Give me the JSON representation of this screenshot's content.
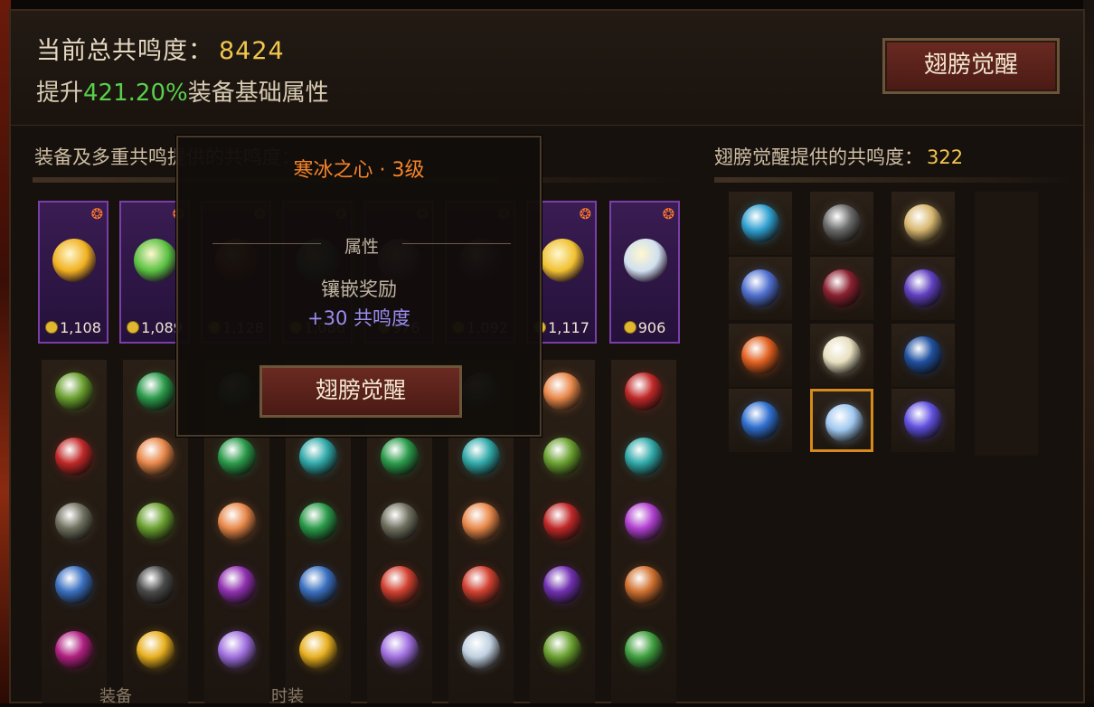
{
  "header": {
    "total_label": "当前总共鸣度：",
    "total_value": "8424",
    "boost_prefix": "提升",
    "boost_pct": "421.20%",
    "boost_suffix": "装备基础属性",
    "awaken_button": "翅膀觉醒"
  },
  "equipment": {
    "title": "装备及多重共鸣提供的共鸣度：",
    "cards": [
      {
        "price": "1,108",
        "color": "#f0b020"
      },
      {
        "price": "1,089",
        "color": "#58c040"
      },
      {
        "price": "1,128",
        "color": "#c04020"
      },
      {
        "price": "1,086",
        "color": "#30a0c0"
      },
      {
        "price": "976",
        "color": "#a060d0"
      },
      {
        "price": "1,092",
        "color": "#7040a0"
      },
      {
        "price": "1,117",
        "color": "#f0c030"
      },
      {
        "price": "906",
        "color": "#d0e0f0"
      }
    ]
  },
  "wings": {
    "title": "翅膀觉醒提供的共鸣度：",
    "value": "322"
  },
  "tooltip": {
    "title": "寒冰之心 · 3级",
    "section": "属性",
    "bonus_label": "镶嵌奖励",
    "bonus_value": "+30 共鸣度",
    "button": "翅膀觉醒"
  },
  "bottom": {
    "left": "装备",
    "right": "时装"
  },
  "gem_colors": [
    [
      "#6aa030",
      "#c02828",
      "#707060",
      "#3a70c0",
      "#b02080"
    ],
    [
      "#2a9a4a",
      "#e8884a",
      "#6aa030",
      "#4a4a4a",
      "#e8b020"
    ],
    [
      "#2aa0a0",
      "#2a9a4a",
      "#e8884a",
      "#9030b0",
      "#a070e0"
    ],
    [
      "#30a8a8",
      "#30a8a8",
      "#2a9a4a",
      "#3a70c0",
      "#e8b020"
    ],
    [
      "#aa8833",
      "#2a9a4a",
      "#707060",
      "#d04030",
      "#a070e0"
    ],
    [
      "#44aa99",
      "#30a8a8",
      "#e8884a",
      "#d04030",
      "#c0d0e0"
    ],
    [
      "#e8884a",
      "#6aa030",
      "#c02828",
      "#7030b0",
      "#6aa030"
    ],
    [
      "#c02828",
      "#30a8a8",
      "#b040d0",
      "#d07030",
      "#40a040"
    ]
  ],
  "wing_gems": [
    [
      "#30a0d0",
      "#5070d0",
      "#e06020",
      "#3070d0"
    ],
    [
      "#6a6a6a",
      "#8a2030",
      "#e8e0c0",
      "#a0c8f0"
    ],
    [
      "#d8b870",
      "#6040c0",
      "#2050a0",
      "#6050e0"
    ]
  ]
}
